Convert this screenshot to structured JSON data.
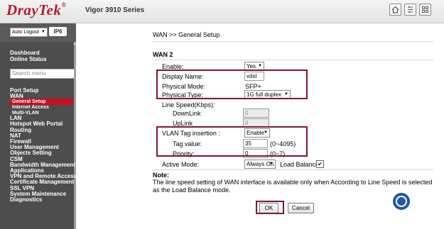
{
  "header": {
    "logo_main": "DrayTek",
    "logo_mark": "®",
    "model": "Vigor 3910 Series",
    "icons": [
      "home-icon",
      "quick-start-icon",
      "menu-grid-icon"
    ]
  },
  "sidebar": {
    "auto_logout": "Auto Logout",
    "ipv6_badge": "IP6",
    "top_items": [
      "Dashboard",
      "Online Status"
    ],
    "search_placeholder": "Search menu",
    "items": [
      {
        "label": "Port Setup",
        "type": "main"
      },
      {
        "label": "WAN",
        "type": "main"
      },
      {
        "label": "General Setup",
        "type": "active"
      },
      {
        "label": "Internet Access",
        "type": "sub"
      },
      {
        "label": "Multi-VLAN",
        "type": "sub"
      },
      {
        "label": "LAN",
        "type": "main"
      },
      {
        "label": "Hotspot Web Portal",
        "type": "main"
      },
      {
        "label": "Routing",
        "type": "main"
      },
      {
        "label": "NAT",
        "type": "main"
      },
      {
        "label": "Firewall",
        "type": "main"
      },
      {
        "label": "User Management",
        "type": "main"
      },
      {
        "label": "Objects Setting",
        "type": "main"
      },
      {
        "label": "CSM",
        "type": "main"
      },
      {
        "label": "Bandwidth Management",
        "type": "main"
      },
      {
        "label": "Applications",
        "type": "main"
      },
      {
        "label": "VPN and Remote Access",
        "type": "main"
      },
      {
        "label": "Certificate Management",
        "type": "main"
      },
      {
        "label": "SSL VPN",
        "type": "main"
      },
      {
        "label": "System Maintenance",
        "type": "main"
      },
      {
        "label": "Diagnostics",
        "type": "main"
      }
    ]
  },
  "main": {
    "breadcrumb": "WAN >> General Setup",
    "section": "WAN 2",
    "enable_label": "Enable:",
    "enable_value": "Yes",
    "display_name_label": "Display Name:",
    "display_name_value": "vdsl",
    "physical_mode_label": "Physical Mode:",
    "physical_mode_value": "SFP+",
    "physical_type_label": "Physical Type:",
    "physical_type_value": "1G full duplex",
    "line_speed_label": "Line Speed(Kbps):",
    "downlink_label": "DownLink",
    "downlink_value": "0",
    "uplink_label": "UpLink",
    "uplink_value": "0",
    "vlan_label": "VLAN Tag insertion :",
    "vlan_value": "Enable",
    "tag_label": "Tag value:",
    "tag_value": "35",
    "tag_range": "(0~4095)",
    "priority_label": "Priority:",
    "priority_value": "0",
    "priority_range": "(0~7)",
    "active_mode_label": "Active Mode:",
    "active_mode_value": "Always On",
    "load_balance_label": "Load Balance:",
    "load_balance_checked": "✔",
    "note_title": "Note:",
    "note_text": "The line speed setting of WAN interface is available only when According to Line Speed is selected as the Load Balance mode.",
    "ok_label": "OK",
    "cancel_label": "Cancel"
  },
  "colors": {
    "brand_red": "#b8192b",
    "highlight_box": "#7d1630",
    "sidebar_bg": "#4d4d4d",
    "active_item": "#c8101e"
  }
}
